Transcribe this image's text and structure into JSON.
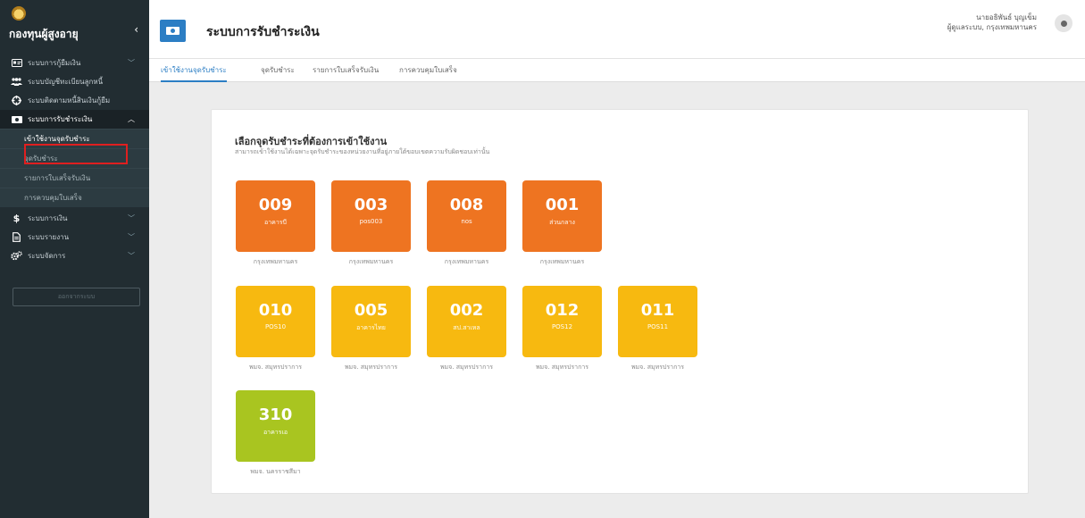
{
  "sidebar": {
    "brand": "กองทุนผู้สูงอายุ",
    "toggle": "‹",
    "items": [
      {
        "label": "ระบบการกู้ยืมเงิน"
      },
      {
        "label": "ระบบบัญชีทะเบียนลูกหนี้"
      },
      {
        "label": "ระบบติดตามหนี้สินเงินกู้ยืม"
      },
      {
        "label": "ระบบการรับชำระเงิน"
      },
      {
        "label": "ระบบการเงิน"
      },
      {
        "label": "ระบบรายงาน"
      },
      {
        "label": "ระบบจัดการ"
      }
    ],
    "sub_items": [
      {
        "label": "เข้าใช้งานจุดรับชำระ"
      },
      {
        "label": "จุดรับชำระ"
      },
      {
        "label": "รายการใบเสร็จรับเงิน"
      },
      {
        "label": "การควบคุมใบเสร็จ"
      }
    ],
    "logout_label": "ออกจากระบบ",
    "highlight_color": "#e01f1f"
  },
  "header": {
    "title": "ระบบการรับชำระเงิน",
    "user_name": "นายอธิพันธ์ บุญเข็ม",
    "user_role": "ผู้ดูแลระบบ, กรุงเทพมหานคร",
    "accent": "#2c7ec4"
  },
  "tabs": [
    {
      "label": "เข้าใช้งานจุดรับชำระ",
      "active": true
    },
    {
      "label": "จุดรับชำระ",
      "active": false
    },
    {
      "label": "รายการใบเสร็จรับเงิน",
      "active": false
    },
    {
      "label": "การควบคุมใบเสร็จ",
      "active": false
    }
  ],
  "panel": {
    "title": "เลือกจุดรับชำระที่ต้องการเข้าใช้งาน",
    "subtitle": "สามารถเข้าใช้งานได้เฉพาะจุดรับชำระของหน่วยงานที่อยู่ภายใต้ขอบเขตความรับผิดชอบเท่านั้น"
  },
  "tile_colors": {
    "orange": "#ee7421",
    "yellow": "#f7b910",
    "green": "#a9c520"
  },
  "payment_points": [
    {
      "code": "009",
      "name": "อาคารบี",
      "dept": "กรุงเทพมหานคร",
      "color": "orange"
    },
    {
      "code": "003",
      "name": "pos003",
      "dept": "กรุงเทพมหานคร",
      "color": "orange"
    },
    {
      "code": "008",
      "name": "nos",
      "dept": "กรุงเทพมหานคร",
      "color": "orange"
    },
    {
      "code": "001",
      "name": "ส่วนกลาง",
      "dept": "กรุงเทพมหานคร",
      "color": "orange"
    },
    {
      "code": "010",
      "name": "POS10",
      "dept": "พมจ. สมุทรปราการ",
      "color": "yellow"
    },
    {
      "code": "005",
      "name": "อาคารไทย",
      "dept": "พมจ. สมุทรปราการ",
      "color": "yellow"
    },
    {
      "code": "002",
      "name": "สป.สาเหล",
      "dept": "พมจ. สมุทรปราการ",
      "color": "yellow"
    },
    {
      "code": "012",
      "name": "POS12",
      "dept": "พมจ. สมุทรปราการ",
      "color": "yellow"
    },
    {
      "code": "011",
      "name": "POS11",
      "dept": "พมจ. สมุทรปราการ",
      "color": "yellow"
    },
    {
      "code": "310",
      "name": "อาคารเอ",
      "dept": "พมจ. นครราชสีมา",
      "color": "green"
    }
  ]
}
